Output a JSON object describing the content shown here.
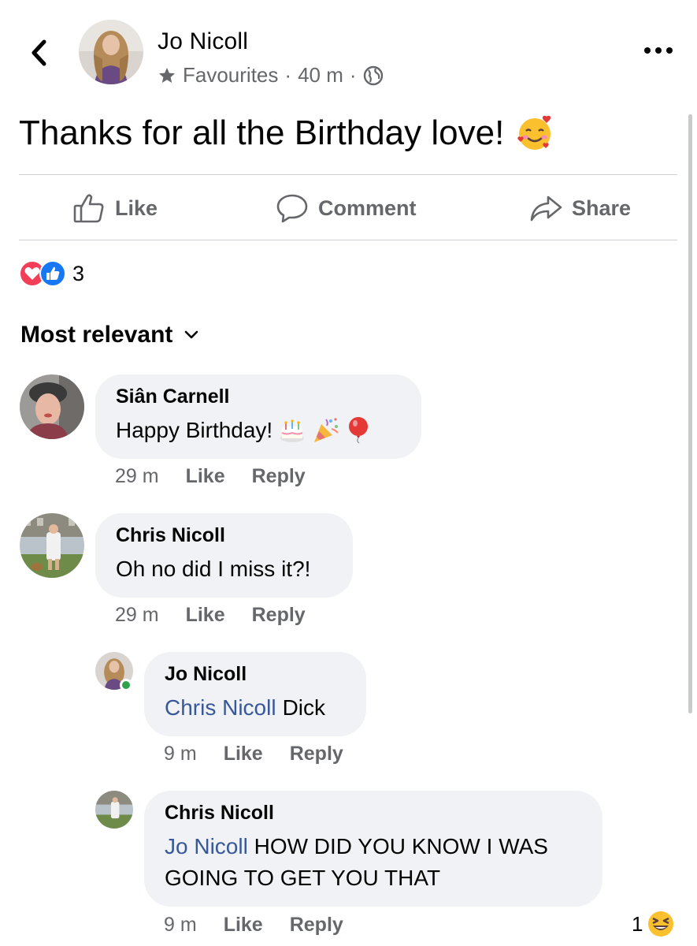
{
  "header": {
    "author": "Jo Nicoll",
    "audience": "Favourites",
    "time": "40 m",
    "separator": "·"
  },
  "post": {
    "text": "Thanks for all the Birthday love!",
    "emoji": "smiling-face-with-hearts"
  },
  "actions": {
    "like": "Like",
    "comment": "Comment",
    "share": "Share"
  },
  "reactions": {
    "count": "3",
    "types": [
      "love",
      "like"
    ],
    "colors": {
      "love": "#f33e58",
      "like": "#1877f2"
    }
  },
  "sort": {
    "label": "Most relevant"
  },
  "comments": [
    {
      "name": "Siân Carnell",
      "text": "Happy Birthday!",
      "emojis": [
        "birthday-cake",
        "party-popper",
        "balloon"
      ],
      "time": "29 m",
      "like": "Like",
      "reply": "Reply"
    },
    {
      "name": "Chris Nicoll",
      "text": "Oh no did I miss it?!",
      "time": "29 m",
      "like": "Like",
      "reply": "Reply"
    }
  ],
  "replies": [
    {
      "name": "Jo Nicoll",
      "mention": "Chris Nicoll",
      "text": "Dick",
      "online": true,
      "time": "9 m",
      "like": "Like",
      "reply": "Reply"
    },
    {
      "name": "Chris Nicoll",
      "mention": "Jo Nicoll",
      "text_line1": "HOW DID YOU KNOW I WAS",
      "text_line2": "GOING TO GET YOU THAT",
      "time": "9 m",
      "like": "Like",
      "reply": "Reply",
      "reaction_count": "1",
      "reaction": "laughing-face"
    }
  ],
  "colors": {
    "secondary_text": "#65676b",
    "mention": "#385898",
    "bubble": "#f0f2f5",
    "online": "#31a24c"
  }
}
